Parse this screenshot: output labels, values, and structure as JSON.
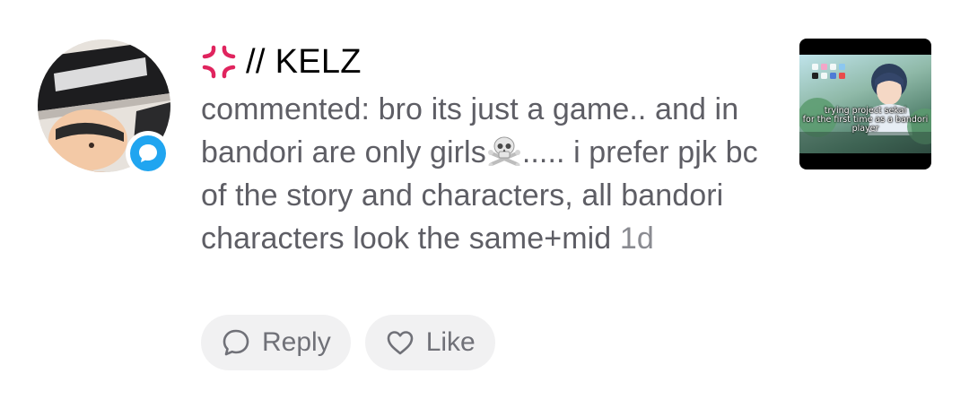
{
  "comment": {
    "username": "// KELZ",
    "username_icon": "anger-symbol-icon",
    "text_part1": "commented: bro its just a game.. and in bandori are only girls",
    "emoji": "skull-crossbones-icon",
    "text_part2": "..... i prefer pjk bc of the story and characters, all bandori characters look the same+mid",
    "timestamp": "1d"
  },
  "actions": {
    "reply_label": "Reply",
    "like_label": "Like"
  },
  "thumbnail": {
    "caption_line1": "trying project sekai",
    "caption_line2": "for the first time as a bandori",
    "caption_line3": "player"
  },
  "colors": {
    "badge": "#20a5f0",
    "anger_icon": "#e0245e",
    "comment_text": "#5e5e65",
    "pill_bg": "#f1f1f2"
  }
}
